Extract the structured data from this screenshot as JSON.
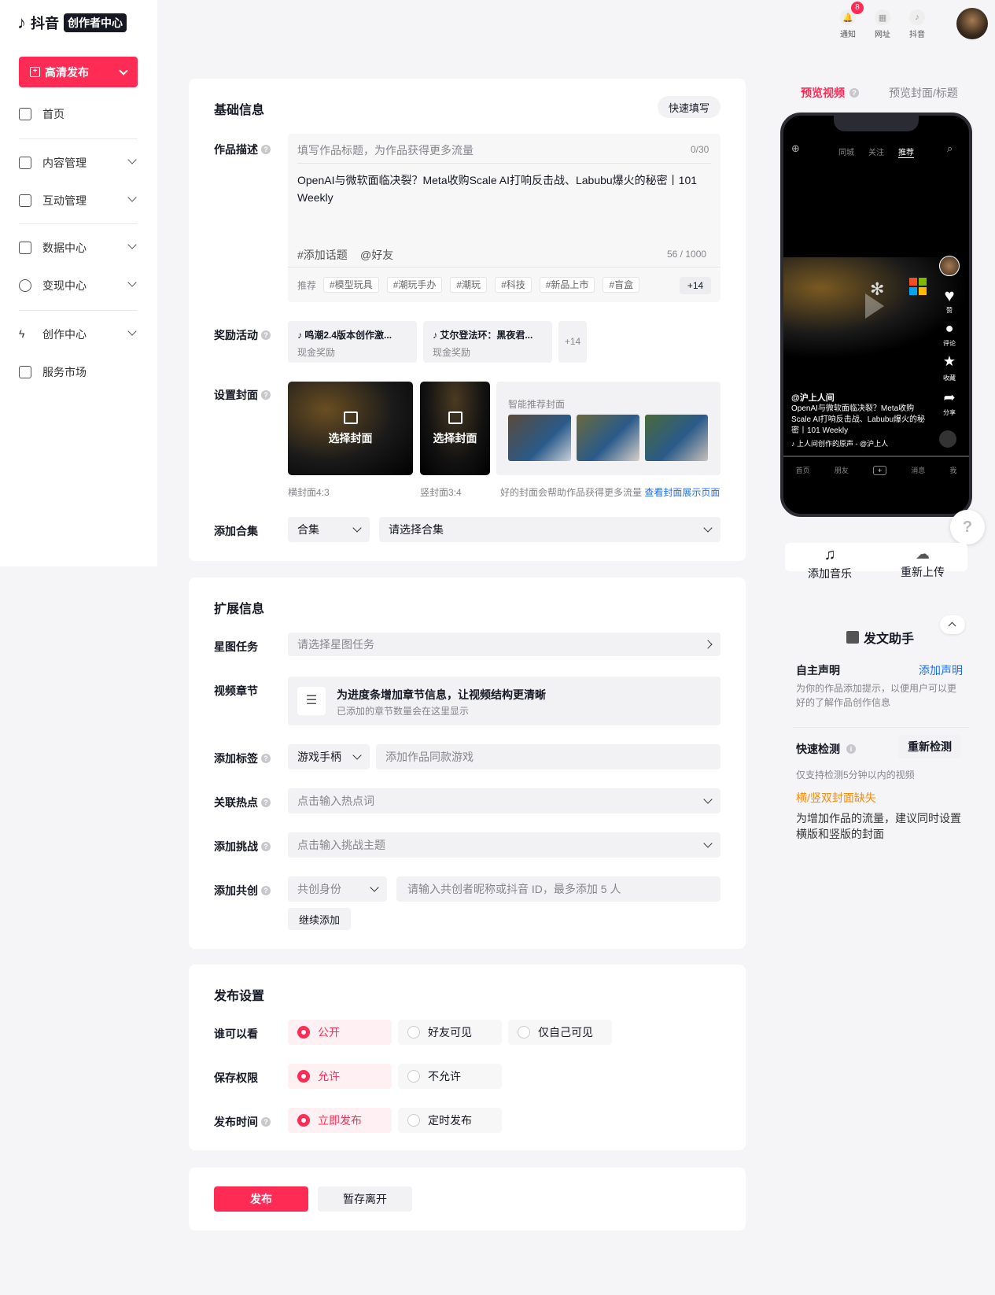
{
  "brand": {
    "name": "抖音",
    "badge": "创作者中心"
  },
  "sidebar": {
    "publish_label": "高清发布",
    "items": [
      {
        "label": "首页"
      },
      {
        "label": "内容管理"
      },
      {
        "label": "互动管理"
      },
      {
        "label": "数据中心"
      },
      {
        "label": "变现中心"
      },
      {
        "label": "创作中心"
      },
      {
        "label": "服务市场"
      }
    ]
  },
  "topbar": {
    "notify_label": "通知",
    "notify_count": "8",
    "site_label": "网址",
    "douyin_label": "抖音"
  },
  "basic": {
    "title": "基础信息",
    "quick_fill": "快速填写",
    "desc_label": "作品描述",
    "title_placeholder": "填写作品标题，为作品获得更多流量",
    "title_count": "0/30",
    "desc_text": "OpenAI与微软面临决裂？Meta收购Scale AI打响反击战、Labubu爆火的秘密丨101 Weekly",
    "add_topic": "#添加话题",
    "mention": "@好友",
    "desc_count": "56 / 1000",
    "recommend_label": "推荐",
    "tags": [
      "#模型玩具",
      "#潮玩手办",
      "#潮玩",
      "#科技",
      "#新品上市",
      "#盲盒"
    ],
    "more_tags": "+14",
    "activity_label": "奖励活动",
    "activities": [
      {
        "title": "鸣潮2.4版本创作激...",
        "sub": "现金奖励"
      },
      {
        "title": "艾尔登法环：黑夜君...",
        "sub": "现金奖励"
      }
    ],
    "more_activities": "+14",
    "cover_label": "设置封面",
    "choose_cover": "选择封面",
    "cover_h": "横封面4:3",
    "cover_v": "竖封面3:4",
    "smart_cover": "智能推荐封面",
    "cover_tip": "好的封面会帮助作品获得更多流量",
    "cover_link": "查看封面展示页面",
    "collection_label": "添加合集",
    "collection_type": "合集",
    "collection_placeholder": "请选择合集"
  },
  "ext": {
    "title": "扩展信息",
    "star_label": "星图任务",
    "star_placeholder": "请选择星图任务",
    "chapter_label": "视频章节",
    "chapter_title": "为进度条增加章节信息，让视频结构更清晰",
    "chapter_sub": "已添加的章节数量会在这里显示",
    "tag_label": "添加标签",
    "tag_type": "游戏手柄",
    "tag_placeholder": "添加作品同款游戏",
    "hot_label": "关联热点",
    "hot_placeholder": "点击输入热点词",
    "challenge_label": "添加挑战",
    "challenge_placeholder": "点击输入挑战主题",
    "cocreate_label": "添加共创",
    "cocreate_role": "共创身份",
    "cocreate_placeholder": "请输入共创者昵称或抖音 ID，最多添加 5 人",
    "continue_add": "继续添加"
  },
  "publish": {
    "title": "发布设置",
    "who_label": "谁可以看",
    "who_options": [
      "公开",
      "好友可见",
      "仅自己可见"
    ],
    "save_label": "保存权限",
    "save_options": [
      "允许",
      "不允许"
    ],
    "time_label": "发布时间",
    "time_options": [
      "立即发布",
      "定时发布"
    ],
    "submit": "发布",
    "draft": "暂存离开"
  },
  "preview": {
    "tab_video": "预览视频",
    "tab_cover": "预览封面/标题",
    "phone_tabs": [
      "同城",
      "关注",
      "推荐"
    ],
    "author": "@沪上人间",
    "caption": "OpenAI与微软面临决裂？Meta收购Scale AI打响反击战、Labubu爆火的秘密丨101 Weekly",
    "music": "上人间创作的原声 - @沪上人",
    "side": [
      "赞",
      "评论",
      "收藏",
      "分享"
    ],
    "bottom_nav": [
      "首页",
      "朋友",
      "消息",
      "我"
    ],
    "add_music": "添加音乐",
    "reupload": "重新上传"
  },
  "assistant": {
    "title": "发文助手",
    "decl_title": "自主声明",
    "decl_link": "添加声明",
    "decl_desc": "为你的作品添加提示，以便用户可以更好的了解作品创作信息",
    "check_title": "快速检测",
    "recheck": "重新检测",
    "check_desc": "仅支持检测5分钟以内的视频",
    "warn_title": "横/竖双封面缺失",
    "warn_desc": "为增加作品的流量，建议同时设置横版和竖版的封面"
  },
  "colors": {
    "brand": "#fe2c55",
    "link": "#1d6ef0",
    "warn": "#ff8a00"
  }
}
